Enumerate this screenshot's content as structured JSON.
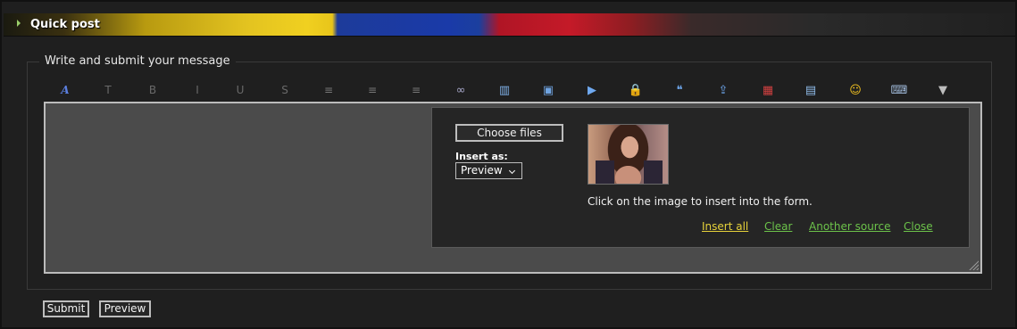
{
  "header": {
    "title": "Quick post"
  },
  "form": {
    "legend": "Write and submit your message"
  },
  "toolbar": {
    "buttons": [
      {
        "icon": "font-style-icon",
        "glyph": "A"
      },
      {
        "icon": "font-size-icon",
        "glyph": "T"
      },
      {
        "icon": "bold-icon",
        "glyph": "B"
      },
      {
        "icon": "italic-icon",
        "glyph": "I"
      },
      {
        "icon": "underline-icon",
        "glyph": "U"
      },
      {
        "icon": "strikethrough-icon",
        "glyph": "S"
      },
      {
        "icon": "align-left-icon",
        "glyph": "≡"
      },
      {
        "icon": "align-center-icon",
        "glyph": "≡"
      },
      {
        "icon": "align-right-icon",
        "glyph": "≡"
      },
      {
        "icon": "link-icon",
        "glyph": "∞"
      },
      {
        "icon": "book-icon",
        "glyph": "▥"
      },
      {
        "icon": "image-icon",
        "glyph": "▣"
      },
      {
        "icon": "video-icon",
        "glyph": "▶"
      },
      {
        "icon": "lock-icon",
        "glyph": "🔒"
      },
      {
        "icon": "quote-icon",
        "glyph": "❝"
      },
      {
        "icon": "upload-icon",
        "glyph": "⇪"
      },
      {
        "icon": "color-icon",
        "glyph": "▦"
      },
      {
        "icon": "table-icon",
        "glyph": "▤"
      },
      {
        "icon": "smiley-icon",
        "glyph": "☺"
      },
      {
        "icon": "keyboard-icon",
        "glyph": "⌨"
      },
      {
        "icon": "more-icon",
        "glyph": "▼"
      }
    ]
  },
  "upload": {
    "choose_label": "Choose files",
    "insert_as_label": "Insert as:",
    "insert_as_value": "Preview",
    "help_text": "Click on the image to insert into the form.",
    "links": {
      "insert_all": "Insert all",
      "clear": "Clear",
      "another_source": "Another source",
      "close": "Close"
    }
  },
  "actions": {
    "submit": "Submit",
    "preview": "Preview"
  },
  "colors": {
    "link_yellow": "#e6d23a",
    "link_green": "#6cc24a"
  }
}
